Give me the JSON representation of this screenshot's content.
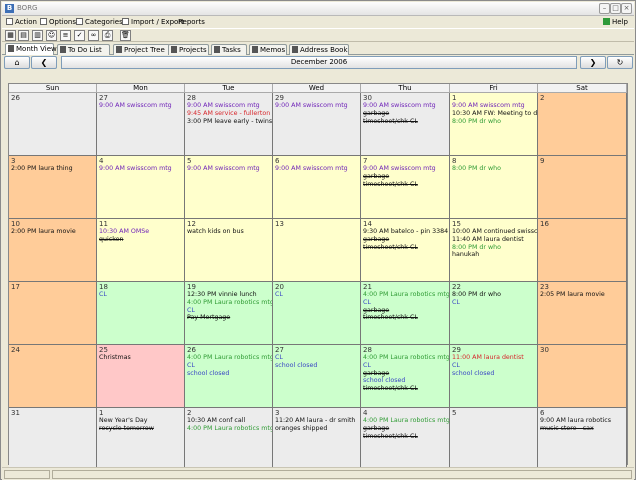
{
  "window": {
    "title": "BORG",
    "app_icon": "B"
  },
  "menu": [
    {
      "label": "Action",
      "icon": "action-icon"
    },
    {
      "label": "Options",
      "icon": "options-icon"
    },
    {
      "label": "Categories",
      "icon": "categories-icon"
    },
    {
      "label": "Import / Export",
      "icon": "import-export-icon"
    },
    {
      "label": "Reports",
      "icon": ""
    }
  ],
  "help": {
    "label": "Help",
    "icon": "help-icon"
  },
  "toolbar_icons": [
    "month-grid-icon",
    "week-grid-icon",
    "day-grid-icon",
    "person-icon",
    "task-list-icon",
    "checklist-icon",
    "binoculars-icon",
    "print-icon",
    "trash-icon"
  ],
  "tabs": [
    {
      "label": "Month View",
      "active": true
    },
    {
      "label": "To Do List",
      "active": false
    },
    {
      "label": "Project Tree",
      "active": false
    },
    {
      "label": "Projects",
      "active": false
    },
    {
      "label": "Tasks",
      "active": false
    },
    {
      "label": "Memos",
      "active": false
    },
    {
      "label": "Address Book",
      "active": false
    }
  ],
  "nav": {
    "home": "⌂",
    "prev": "❮",
    "next": "❯",
    "last": "↻",
    "month": "December 2006"
  },
  "days": [
    "Sun",
    "Mon",
    "Tue",
    "Wed",
    "Thu",
    "Fri",
    "Sat"
  ],
  "colors": {
    "weekend": "#ffcc99",
    "weekday": "#ffffcc",
    "other_month": "#ececec",
    "highlight_green": "#ccffcc",
    "holiday": "#ffc8c8"
  },
  "weeks": [
    [
      {
        "day": "26",
        "bg": "other_month",
        "events": []
      },
      {
        "day": "27",
        "bg": "other_month",
        "events": [
          {
            "t": "9:00 AM swisscom mtg",
            "c": "purple"
          }
        ]
      },
      {
        "day": "28",
        "bg": "other_month",
        "events": [
          {
            "t": "9:00 AM swisscom mtg",
            "c": "purple"
          },
          {
            "t": "9:45 AM service - fullerton",
            "c": "red"
          },
          {
            "t": "3:00 PM leave early - twins - one",
            "c": "black"
          }
        ]
      },
      {
        "day": "29",
        "bg": "other_month",
        "events": [
          {
            "t": "9:00 AM swisscom mtg",
            "c": "purple"
          }
        ]
      },
      {
        "day": "30",
        "bg": "other_month",
        "events": [
          {
            "t": "9:00 AM swisscom mtg",
            "c": "purple"
          },
          {
            "t": "garbage",
            "c": "black",
            "s": true
          },
          {
            "t": "timesheet/chk CL",
            "c": "black",
            "s": true
          }
        ]
      },
      {
        "day": "1",
        "bg": "weekday",
        "events": [
          {
            "t": "9:00 AM swisscom mtg",
            "c": "purple"
          },
          {
            "t": "10:30 AM FW: Meeting to discus",
            "c": "black"
          },
          {
            "t": "8:00 PM dr who",
            "c": "green"
          }
        ]
      },
      {
        "day": "2",
        "bg": "weekend",
        "events": []
      }
    ],
    [
      {
        "day": "3",
        "bg": "weekend",
        "events": [
          {
            "t": "2:00 PM laura thing",
            "c": "black"
          }
        ]
      },
      {
        "day": "4",
        "bg": "weekday",
        "events": [
          {
            "t": "9:00 AM swisscom mtg",
            "c": "purple"
          }
        ]
      },
      {
        "day": "5",
        "bg": "weekday",
        "events": [
          {
            "t": "9:00 AM swisscom mtg",
            "c": "purple"
          }
        ]
      },
      {
        "day": "6",
        "bg": "weekday",
        "events": [
          {
            "t": "9:00 AM swisscom mtg",
            "c": "purple"
          }
        ]
      },
      {
        "day": "7",
        "bg": "weekday",
        "events": [
          {
            "t": "9:00 AM swisscom mtg",
            "c": "purple"
          },
          {
            "t": "garbage",
            "c": "black",
            "s": true
          },
          {
            "t": "timesheet/chk CL",
            "c": "black",
            "s": true
          }
        ]
      },
      {
        "day": "8",
        "bg": "weekday",
        "events": [
          {
            "t": "8:00 PM dr who",
            "c": "green"
          }
        ]
      },
      {
        "day": "9",
        "bg": "weekend",
        "events": []
      }
    ],
    [
      {
        "day": "10",
        "bg": "weekend",
        "events": [
          {
            "t": "2:00 PM laura movie",
            "c": "black"
          }
        ]
      },
      {
        "day": "11",
        "bg": "weekday",
        "events": [
          {
            "t": "10:30 AM OMSe",
            "c": "purple"
          },
          {
            "t": "quicken",
            "c": "black",
            "s": true
          }
        ]
      },
      {
        "day": "12",
        "bg": "weekday",
        "events": [
          {
            "t": "watch kids on bus",
            "c": "black"
          }
        ]
      },
      {
        "day": "13",
        "bg": "weekday",
        "events": []
      },
      {
        "day": "14",
        "bg": "weekday",
        "events": [
          {
            "t": "9:30 AM batelco - pin 3384",
            "c": "black"
          },
          {
            "t": "garbage",
            "c": "black",
            "s": true
          },
          {
            "t": "timesheet/chk CL",
            "c": "black",
            "s": true
          }
        ]
      },
      {
        "day": "15",
        "bg": "weekday",
        "events": [
          {
            "t": "10:00 AM continued swisscom d",
            "c": "black"
          },
          {
            "t": "11:40 AM laura dentist",
            "c": "black"
          },
          {
            "t": "8:00 PM dr who",
            "c": "green"
          },
          {
            "t": "hanukah",
            "c": "black"
          }
        ]
      },
      {
        "day": "16",
        "bg": "weekend",
        "events": []
      }
    ],
    [
      {
        "day": "17",
        "bg": "weekend",
        "events": []
      },
      {
        "day": "18",
        "bg": "highlight_green",
        "events": [
          {
            "t": "CL",
            "c": "blue"
          }
        ]
      },
      {
        "day": "19",
        "bg": "highlight_green",
        "events": [
          {
            "t": "12:30 PM vinnie lunch",
            "c": "black"
          },
          {
            "t": "4:00 PM Laura robotics mtg",
            "c": "green"
          },
          {
            "t": "CL",
            "c": "blue"
          },
          {
            "t": "Pay Mortgage",
            "c": "black",
            "s": true
          }
        ]
      },
      {
        "day": "20",
        "bg": "highlight_green",
        "events": [
          {
            "t": "CL",
            "c": "blue"
          }
        ]
      },
      {
        "day": "21",
        "bg": "highlight_green",
        "events": [
          {
            "t": "4:00 PM Laura robotics mtg",
            "c": "green"
          },
          {
            "t": "CL",
            "c": "blue"
          },
          {
            "t": "garbage",
            "c": "black",
            "s": true
          },
          {
            "t": "timesheet/chk CL",
            "c": "black",
            "s": true
          }
        ]
      },
      {
        "day": "22",
        "bg": "highlight_green",
        "events": [
          {
            "t": "8:00 PM dr who",
            "c": "black"
          },
          {
            "t": "CL",
            "c": "blue"
          }
        ]
      },
      {
        "day": "23",
        "bg": "weekend",
        "events": [
          {
            "t": "2:05 PM laura movie",
            "c": "black"
          }
        ]
      }
    ],
    [
      {
        "day": "24",
        "bg": "weekend",
        "events": []
      },
      {
        "day": "25",
        "bg": "holiday",
        "events": [
          {
            "t": "Christmas",
            "c": "black"
          }
        ]
      },
      {
        "day": "26",
        "bg": "highlight_green",
        "events": [
          {
            "t": "4:00 PM Laura robotics mtg",
            "c": "green"
          },
          {
            "t": "CL",
            "c": "blue"
          },
          {
            "t": "school closed",
            "c": "blue"
          }
        ]
      },
      {
        "day": "27",
        "bg": "highlight_green",
        "events": [
          {
            "t": "CL",
            "c": "blue"
          },
          {
            "t": "school closed",
            "c": "blue"
          }
        ]
      },
      {
        "day": "28",
        "bg": "highlight_green",
        "events": [
          {
            "t": "4:00 PM Laura robotics mtg",
            "c": "green"
          },
          {
            "t": "CL",
            "c": "blue"
          },
          {
            "t": "garbage",
            "c": "black",
            "s": true
          },
          {
            "t": "school closed",
            "c": "blue"
          },
          {
            "t": "timesheet/chk CL",
            "c": "black",
            "s": true
          }
        ]
      },
      {
        "day": "29",
        "bg": "highlight_green",
        "events": [
          {
            "t": "11:00 AM laura dentist",
            "c": "red"
          },
          {
            "t": "CL",
            "c": "blue"
          },
          {
            "t": "school closed",
            "c": "blue"
          }
        ]
      },
      {
        "day": "30",
        "bg": "weekend",
        "events": []
      }
    ],
    [
      {
        "day": "31",
        "bg": "other_month",
        "events": []
      },
      {
        "day": "1",
        "bg": "other_month",
        "events": [
          {
            "t": "New Year's Day",
            "c": "black"
          },
          {
            "t": "recycle tomorrow",
            "c": "black",
            "s": true
          }
        ]
      },
      {
        "day": "2",
        "bg": "other_month",
        "events": [
          {
            "t": "10:30 AM conf call",
            "c": "black"
          },
          {
            "t": "4:00 PM Laura robotics mtg",
            "c": "green"
          }
        ]
      },
      {
        "day": "3",
        "bg": "other_month",
        "events": [
          {
            "t": "11:20 AM laura - dr smith",
            "c": "black"
          },
          {
            "t": "oranges shipped",
            "c": "black"
          }
        ]
      },
      {
        "day": "4",
        "bg": "other_month",
        "events": [
          {
            "t": "4:00 PM Laura robotics mtg",
            "c": "green"
          },
          {
            "t": "garbage",
            "c": "black",
            "s": true
          },
          {
            "t": "timesheet/chk CL",
            "c": "black",
            "s": true
          }
        ]
      },
      {
        "day": "5",
        "bg": "other_month",
        "events": []
      },
      {
        "day": "6",
        "bg": "other_month",
        "events": [
          {
            "t": "9:00 AM laura robotics",
            "c": "black"
          },
          {
            "t": "music store - sax",
            "c": "black",
            "s": true
          }
        ]
      }
    ]
  ]
}
